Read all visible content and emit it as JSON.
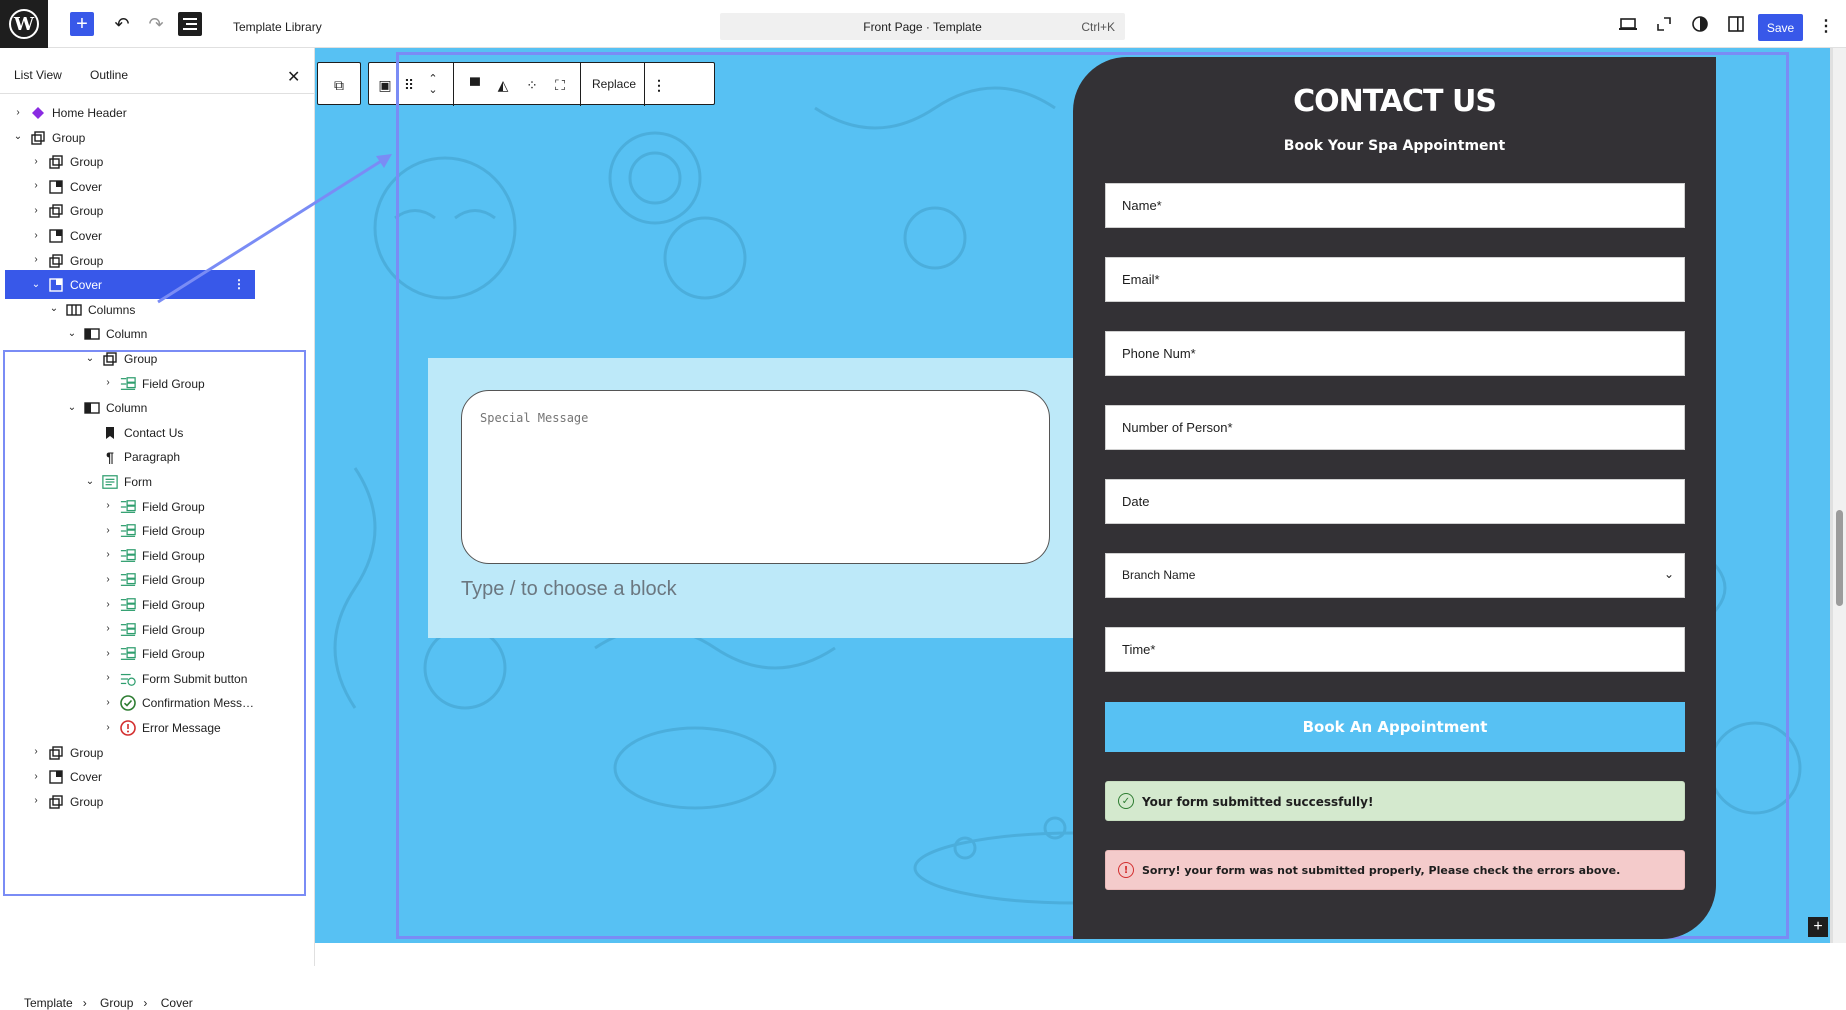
{
  "topbar": {
    "title": "Template Library",
    "command_bar": "Front Page · Template",
    "shortcut": "Ctrl+K",
    "save_label": "Save"
  },
  "sidebar": {
    "tabs": [
      "List View",
      "Outline"
    ],
    "tree": [
      {
        "label": "Home Header",
        "icon": "diamond-icon"
      },
      {
        "label": "Group",
        "icon": "group-icon"
      },
      {
        "label": "Group",
        "icon": "group-icon"
      },
      {
        "label": "Cover",
        "icon": "cover-icon"
      },
      {
        "label": "Group",
        "icon": "group-icon"
      },
      {
        "label": "Cover",
        "icon": "cover-icon"
      },
      {
        "label": "Group",
        "icon": "group-icon"
      },
      {
        "label": "Cover",
        "icon": "cover-icon",
        "selected": true
      },
      {
        "label": "Columns",
        "icon": "columns-icon"
      },
      {
        "label": "Column",
        "icon": "column-icon"
      },
      {
        "label": "Group",
        "icon": "group-icon"
      },
      {
        "label": "Field Group",
        "icon": "field-group-icon"
      },
      {
        "label": "Column",
        "icon": "column-icon"
      },
      {
        "label": "Contact Us",
        "icon": "bookmark-icon"
      },
      {
        "label": "Paragraph",
        "icon": "paragraph-icon"
      },
      {
        "label": "Form",
        "icon": "form-icon"
      },
      {
        "label": "Field Group",
        "icon": "field-group-icon"
      },
      {
        "label": "Field Group",
        "icon": "field-group-icon"
      },
      {
        "label": "Field Group",
        "icon": "field-group-icon"
      },
      {
        "label": "Field Group",
        "icon": "field-group-icon"
      },
      {
        "label": "Field Group",
        "icon": "field-group-icon"
      },
      {
        "label": "Field Group",
        "icon": "field-group-icon"
      },
      {
        "label": "Field Group",
        "icon": "field-group-icon"
      },
      {
        "label": "Form Submit button",
        "icon": "submit-button-icon"
      },
      {
        "label": "Confirmation Mess…",
        "icon": "check-circle-icon"
      },
      {
        "label": "Error Message",
        "icon": "error-circle-icon"
      },
      {
        "label": "Group",
        "icon": "group-icon"
      },
      {
        "label": "Cover",
        "icon": "cover-icon"
      },
      {
        "label": "Group",
        "icon": "group-icon"
      }
    ],
    "breadcrumb": [
      "Template",
      "Group",
      "Cover"
    ]
  },
  "block_toolbar": {
    "replace_label": "Replace"
  },
  "canvas": {
    "special_message_placeholder": "Special Message",
    "type_hint": "Type / to choose a block",
    "form": {
      "title": "CONTACT US",
      "subtitle": "Book Your Spa Appointment",
      "fields": [
        "Name*",
        "Email*",
        "Phone Num*",
        "Number of Person*",
        "Date",
        "Branch Name",
        "Time*"
      ],
      "submit_label": "Book An Appointment",
      "success_message": "Your form submitted successfully!",
      "error_message": "Sorry! your form was not submitted properly, Please check the errors above."
    }
  },
  "colors": {
    "accent": "#3858e9",
    "cover_bg": "#57c1f3",
    "form_panel": "#333135",
    "success_bg": "#d4e9ce",
    "error_bg": "#f4cbcb"
  }
}
